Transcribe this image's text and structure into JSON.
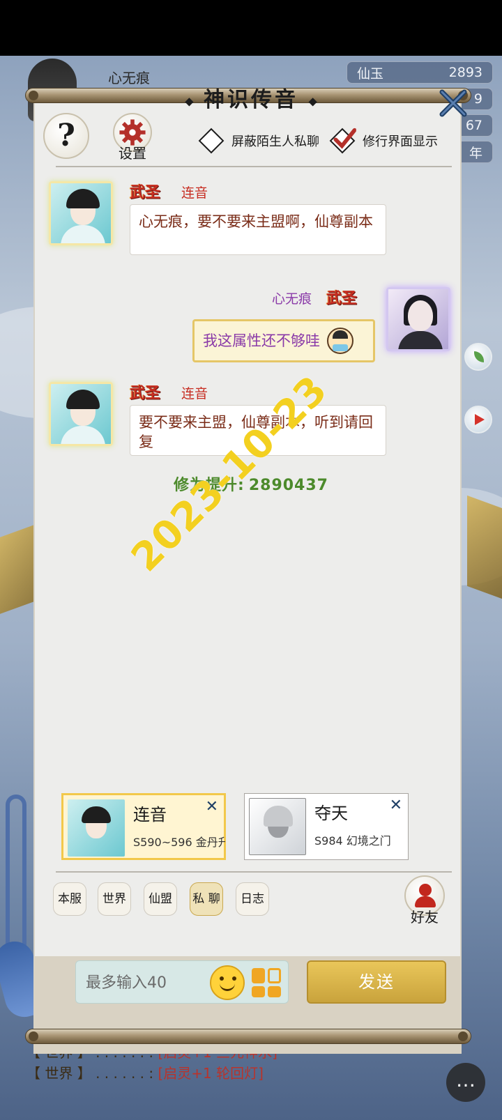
{
  "background": {
    "username": "心无痕",
    "stats": [
      {
        "label": "仙玉",
        "value": "2893"
      },
      {
        "label": "",
        "value": "9"
      },
      {
        "label": "",
        "value": "67"
      },
      {
        "label": "",
        "value": "年"
      }
    ],
    "log_lines": [
      {
        "tag": "【 世界 】",
        "dots": ". . . . . . :",
        "text": "[启灵+1 三元神水]"
      },
      {
        "tag": "【 世界 】",
        "dots": ". . . . . . :",
        "text": "[启灵+1 轮回灯]"
      }
    ],
    "chat_icon": "chat-bubble-icon"
  },
  "dialog": {
    "title": "神识传音",
    "help_label": "?",
    "settings_label": "设置",
    "options": [
      {
        "label": "屏蔽陌生人私聊",
        "checked": false
      },
      {
        "label": "修行界面显示",
        "checked": true
      }
    ]
  },
  "messages": [
    {
      "rank": "武圣",
      "sender": "连音",
      "text": "心无痕，要不要来主盟啊，仙尊副本",
      "self": false
    },
    {
      "rank": "武圣",
      "sender": "心无痕",
      "text": "我这属性还不够哇",
      "self": true
    },
    {
      "rank": "武圣",
      "sender": "连音",
      "text": "要不要来主盟，仙尊副本，听到请回复",
      "self": false
    }
  ],
  "system_line": {
    "label": "修为提升:",
    "value": "2890437"
  },
  "watermark": "2023-10-23",
  "contacts": [
    {
      "name": "连音",
      "server": "S590~596 金丹升",
      "active": true
    },
    {
      "name": "夺天",
      "server": "S984 幻境之门",
      "active": false
    }
  ],
  "tabs": [
    {
      "label": "本服",
      "active": false
    },
    {
      "label": "世界",
      "active": false
    },
    {
      "label": "仙盟",
      "active": false
    },
    {
      "label": "私 聊",
      "active": true
    },
    {
      "label": "日志",
      "active": false
    }
  ],
  "friends_label": "好友",
  "input": {
    "placeholder": "最多输入40",
    "value": ""
  },
  "send_label": "发送",
  "colors": {
    "accent_gold": "#e9c65a",
    "rank_red": "#c72d22",
    "self_purple": "#8a3aa8",
    "exp_green": "#4c8a2b",
    "watermark_yellow": "#f3d020"
  }
}
